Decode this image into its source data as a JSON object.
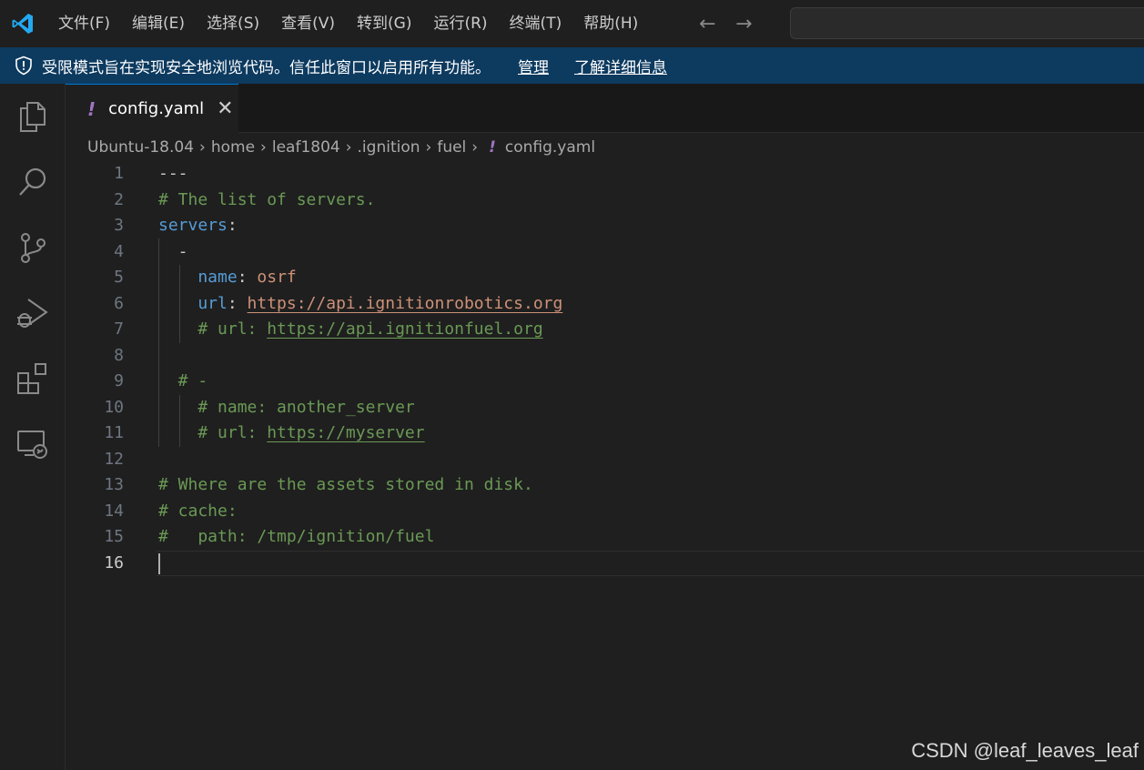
{
  "menu": [
    "文件(F)",
    "编辑(E)",
    "选择(S)",
    "查看(V)",
    "转到(G)",
    "运行(R)",
    "终端(T)",
    "帮助(H)"
  ],
  "nav": {
    "back": "←",
    "forward": "→"
  },
  "banner": {
    "message": "受限模式旨在实现安全地浏览代码。信任此窗口以启用所有功能。",
    "manage": "管理",
    "learn_more": "了解详细信息"
  },
  "tab": {
    "icon": "!",
    "label": "config.yaml",
    "close": "✕"
  },
  "breadcrumb": [
    "Ubuntu-18.04",
    "home",
    "leaf1804",
    ".ignition",
    "fuel",
    "config.yaml"
  ],
  "editor": {
    "lines": [
      {
        "n": "1",
        "tokens": [
          {
            "t": "---",
            "c": "t-punct"
          }
        ]
      },
      {
        "n": "2",
        "tokens": [
          {
            "t": "# The list of servers.",
            "c": "t-comment"
          }
        ]
      },
      {
        "n": "3",
        "tokens": [
          {
            "t": "servers",
            "c": "t-key"
          },
          {
            "t": ":",
            "c": "t-punct"
          }
        ]
      },
      {
        "n": "4",
        "tokens": [
          {
            "t": "  -",
            "c": "t-punct"
          }
        ]
      },
      {
        "n": "5",
        "tokens": [
          {
            "t": "    name",
            "c": "t-key"
          },
          {
            "t": ": ",
            "c": "t-punct"
          },
          {
            "t": "osrf",
            "c": "t-str"
          }
        ]
      },
      {
        "n": "6",
        "tokens": [
          {
            "t": "    url",
            "c": "t-key"
          },
          {
            "t": ": ",
            "c": "t-punct"
          },
          {
            "t": "https://api.ignitionrobotics.org",
            "c": "t-str u-link"
          }
        ]
      },
      {
        "n": "7",
        "tokens": [
          {
            "t": "    # url: ",
            "c": "t-comment"
          },
          {
            "t": "https://api.ignitionfuel.org",
            "c": "t-comment u-link"
          }
        ]
      },
      {
        "n": "8",
        "tokens": []
      },
      {
        "n": "9",
        "tokens": [
          {
            "t": "  # -",
            "c": "t-comment"
          }
        ]
      },
      {
        "n": "10",
        "tokens": [
          {
            "t": "    # name: another_server",
            "c": "t-comment"
          }
        ]
      },
      {
        "n": "11",
        "tokens": [
          {
            "t": "    # url: ",
            "c": "t-comment"
          },
          {
            "t": "https://myserver",
            "c": "t-comment u-link"
          }
        ]
      },
      {
        "n": "12",
        "tokens": []
      },
      {
        "n": "13",
        "tokens": [
          {
            "t": "# Where are the assets stored in disk.",
            "c": "t-comment"
          }
        ]
      },
      {
        "n": "14",
        "tokens": [
          {
            "t": "# cache:",
            "c": "t-comment"
          }
        ]
      },
      {
        "n": "15",
        "tokens": [
          {
            "t": "#   path: /tmp/ignition/fuel",
            "c": "t-comment"
          }
        ]
      },
      {
        "n": "16",
        "tokens": [],
        "active": true
      }
    ]
  },
  "watermark": "CSDN @leaf_leaves_leaf",
  "colors": {
    "accent": "#0078d4",
    "banner_bg": "#0d3a5f",
    "comment": "#6a9955",
    "key": "#569cd6",
    "string": "#ce9178"
  }
}
